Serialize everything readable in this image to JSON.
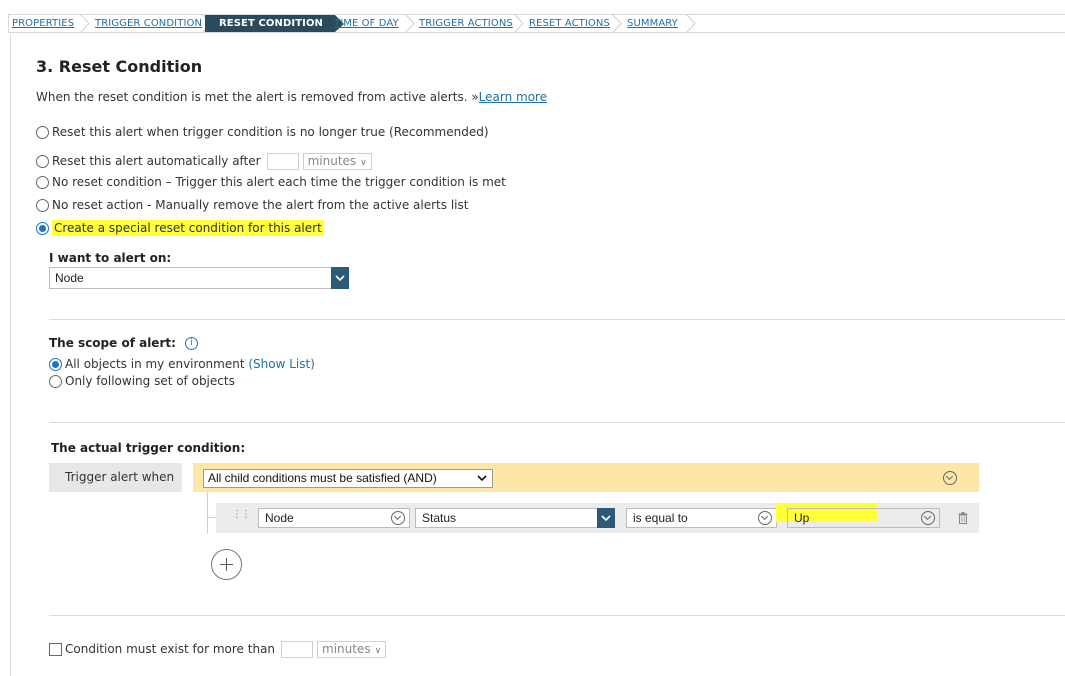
{
  "wizard": {
    "steps": [
      {
        "label": "PROPERTIES"
      },
      {
        "label": "TRIGGER CONDITION"
      },
      {
        "label": "RESET CONDITION"
      },
      {
        "label": "TIME OF DAY"
      },
      {
        "label": "TRIGGER ACTIONS"
      },
      {
        "label": "RESET ACTIONS"
      },
      {
        "label": "SUMMARY"
      }
    ],
    "active_step": "RESET CONDITION"
  },
  "page": {
    "title": "3. Reset Condition",
    "description": "When the reset condition is met the alert is removed from active alerts. »",
    "learn_more": "Learn more"
  },
  "reset_options": [
    {
      "label": "Reset this alert when trigger condition is no longer true (Recommended)",
      "selected": false
    },
    {
      "label": "Reset this alert automatically after",
      "selected": false,
      "unit": "minutes"
    },
    {
      "label": "No reset condition – Trigger this alert each time the trigger condition is met",
      "selected": false
    },
    {
      "label": "No reset action - Manually remove the alert from the active alerts list",
      "selected": false
    },
    {
      "label": "Create a special reset condition for this alert",
      "selected": true
    }
  ],
  "alert_on": {
    "label": "I want to alert on:",
    "value": "Node"
  },
  "scope": {
    "label": "The scope of alert:",
    "info_icon": "info-icon",
    "options": [
      {
        "label": "All objects in my environment",
        "link": "(Show List)",
        "selected": true
      },
      {
        "label": "Only following set of objects",
        "selected": false
      }
    ]
  },
  "trigger": {
    "label": "The actual trigger condition:",
    "when_label": "Trigger alert when",
    "group_select": "All child conditions must be satisfied (AND)",
    "condition": {
      "object": "Node",
      "field": "Status",
      "operator": "is equal to",
      "value": "Up"
    }
  },
  "duration": {
    "label": "Condition must exist for more than",
    "unit": "minutes",
    "checked": false
  },
  "colors": {
    "active_step": "#2b4a5e",
    "link": "#1f6fa8",
    "highlight": "#ffff3a",
    "trigger_band": "#fde7a6",
    "select_button": "#2b5a78"
  }
}
